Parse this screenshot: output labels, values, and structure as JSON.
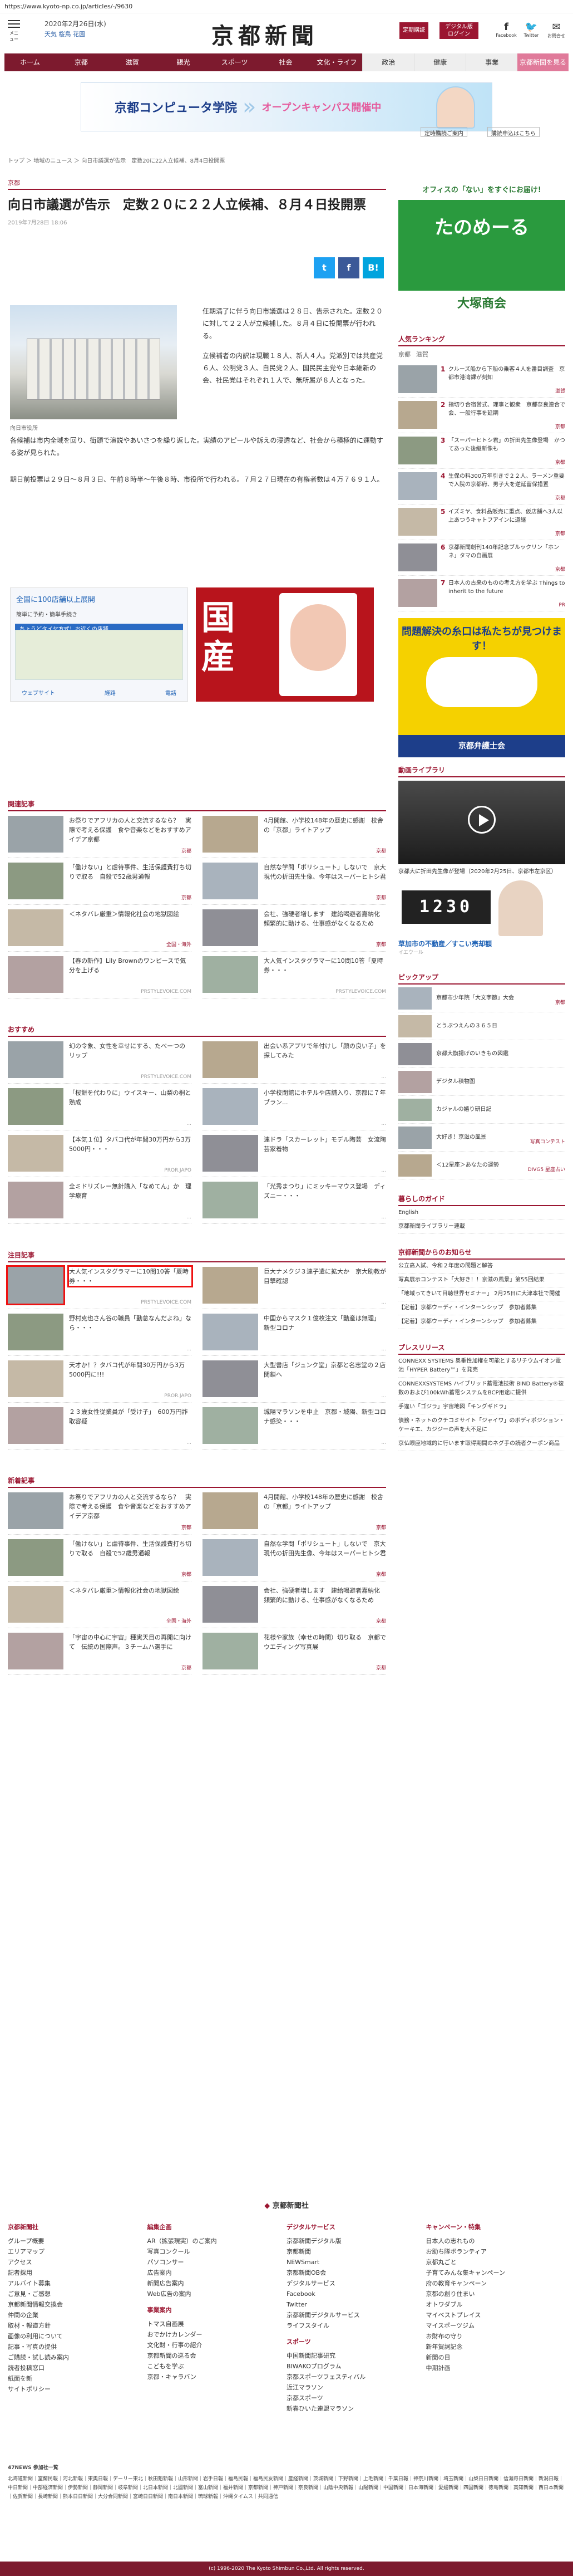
{
  "url": "https://www.kyoto-np.co.jp/articles/-/9630",
  "header": {
    "menu_label": "メニュー",
    "date": "2020年2月26日(水)",
    "weather": [
      "天気",
      "桜鳥",
      "花園"
    ],
    "logo": "京都新聞",
    "btn_member": "定期購読",
    "btn_digital": "デジタル版ログイン",
    "facebook": "Facebook",
    "twitter": "Twitter",
    "mail": "お問合せ"
  },
  "nav": [
    "ホーム",
    "京都",
    "滋賀",
    "観光",
    "スポーツ",
    "社会",
    "文化・ライフ",
    "政治",
    "健康",
    "事業",
    "京都新聞を見る"
  ],
  "banner": {
    "school": "京都コンピュータ学院",
    "campus": "オープンキャンパス開催中"
  },
  "breadcrumb": "トップ ＞ 地域のニュース ＞ 向日市議選が告示　定数20に22人立候補、8月4日投開票",
  "tools": [
    "定時購読ご案内",
    "購読申込はこちら"
  ],
  "article": {
    "category": "京都",
    "title": "向日市議選が告示　定数２０に２２人立候補、８月４日投開票",
    "date": "2019年7月28日 18:06",
    "photo_caption": "向日市役所",
    "p1": "任期満了に伴う向日市議選は２８日、告示された。定数２０に対して２２人が立候補した。８月４日に投開票が行われる。",
    "p2": "立候補者の内訳は現職１８人、新人４人。党派別では共産党６人、公明党３人、自民党２人、国民民主党や日本維新の会、社民党はそれぞれ１人で、無所属が８人となった。",
    "p3": "各候補は市内全域を回り、街頭で演説やあいさつを繰り返した。実績のアピールや訴えの浸透など、社会から積極的に運動する姿が見られた。",
    "p4": "期日前投票は２９日～８月３日、午前８時半～午後８時、市役所で行われる。７月２７日現在の有権者数は４万７６９１人。"
  },
  "map_ad": {
    "title": "全国に100店舗以上展開",
    "sub": "簡単に予約・簡単手続き",
    "bar": "ちょうどタイヤ方式！お近くの店舗",
    "actions": [
      "ウェブサイト",
      "経路",
      "電話"
    ]
  },
  "food_ad": {
    "text": "国産"
  },
  "related": {
    "heading": "関連記事",
    "items": [
      {
        "text": "お祭りでアフリカの人と交流するなら？　実際で考える保護　食や音楽などをおすすめアイデア京都",
        "src": "京都"
      },
      {
        "text": "4月開館、小学校148年の歴史に感謝　校舎の「京都」ライトアップ",
        "src": "京都"
      },
      {
        "text": "「働けない」と虐待事件、生活保護費打ち切りで取る　自殺で52歳男通報",
        "src": "京都"
      },
      {
        "text": "自然な学問「ポリシュート」しないで　京大現代の折田先生像、今年はスーパーヒトシ君",
        "src": "京都"
      },
      {
        "text": "＜ネタバレ厳重＞情報化社会の地獄図絵",
        "src": "全国・海外"
      },
      {
        "text": "会社、強硬者増します　建給喝避者嘉納化　頻繁的に動ける、仕事感がなくなるため",
        "src": "京都"
      },
      {
        "text": "【春の新作】Lily Brownのワンピースで気分を上げる",
        "src": "PRSTYLEVOICE.COM"
      },
      {
        "text": "大人気インスタグラマーに10問10答「夏時券・・・",
        "src": "PRSTYLEVOICE.COM"
      }
    ]
  },
  "osusume": {
    "heading": "おすすめ",
    "items": [
      {
        "text": "幻の令象、女性を幸せにする、たべーつのリップ",
        "src": "PRSTYLEVOICE.COM"
      },
      {
        "text": "出会い系アプリで年付けし「顔の良い子」を探してみた",
        "src": "..."
      },
      {
        "text": "「桜餅を代わりに」ウイスキー、山梨の桐と熟成",
        "src": "..."
      },
      {
        "text": "小学校閉館にホテルや店舗入り、京都に７年ブラン...",
        "src": "..."
      },
      {
        "text": "【本気１位】タバコ代が年間30万円から3万5000円・・・",
        "src": "PROR.JAPO"
      },
      {
        "text": "連ドラ「スカーレット」モデル陶芸　女流陶芸家着物",
        "src": "..."
      },
      {
        "text": "全ミドリズレー無針購入「なめてん」か　理学療育",
        "src": "..."
      },
      {
        "text": "「光秀まつり」にミッキーマウス登場　ディズニー・・・",
        "src": "..."
      }
    ]
  },
  "chuumoku": {
    "heading": "注目記事",
    "items": [
      {
        "text": "大人気インスタグラマーに10問10答「夏時券・・・",
        "src": "PRSTYLEVOICE.COM"
      },
      {
        "text": "巨大ナメクジ３連子遣に拡大か　京大助教が目撃確認",
        "src": "..."
      },
      {
        "text": "野村克也さん谷の職員「勤怠なんだよね」なら・・・",
        "src": "..."
      },
      {
        "text": "中国からマスク１億枚注文「動産は無理」　新型コロナ",
        "src": "..."
      },
      {
        "text": "天才か！？タバコ代が年間30万円から3万5000円に!!!",
        "src": "PROR.JAPO"
      },
      {
        "text": "大型書店「ジュンク堂」京都と名志堂の２店閉鎖へ",
        "src": "..."
      },
      {
        "text": "２３歳女性従業員が「受け子」　600万円詐取容疑",
        "src": "..."
      },
      {
        "text": "城陽マラソンを中止　京都・城陽、新型コロナ感染・・・",
        "src": "..."
      }
    ]
  },
  "shinchaku": {
    "heading": "新着記事",
    "items": [
      {
        "text": "お祭りでアフリカの人と交流するなら？　実際で考える保護　食や音楽などをおすすめアイデア京都",
        "src": "京都"
      },
      {
        "text": "4月開館、小学校148年の歴史に感謝　校舎の「京都」ライトアップ",
        "src": "京都"
      },
      {
        "text": "「働けない」と虐待事件、生活保護費打ち切りで取る　自殺で52歳男通報",
        "src": "京都"
      },
      {
        "text": "自然な学問「ポリシュート」しないで　京大現代の折田先生像、今年はスーパーヒトシ君",
        "src": "京都"
      },
      {
        "text": "＜ネタバレ厳重＞情報化社会の地獄図絵",
        "src": "全国・海外"
      },
      {
        "text": "会社、強硬者増します　建給喝避者嘉納化　頻繁的に動ける、仕事感がなくなるため",
        "src": "京都"
      },
      {
        "text": "「宇宙の中心に宇宙」種実天目の再開に向けて　伝統の国際声。３チームハ選手に",
        "src": "京都"
      },
      {
        "text": "花様や家族（幸せの時間）切り取る　京都でウエディング写真展",
        "src": "京都"
      }
    ]
  },
  "sidebar": {
    "top_btns": [
      "定時購読ご案内",
      "購読申込はこちら"
    ],
    "tana_top": "オフィスの「ない」をすぐにお届け!",
    "tana_word": "たのめーる",
    "tana_bottom": "大塚商会",
    "ranking_heading": "人気ランキング",
    "ranking_tabs": [
      "京都",
      "滋賀"
    ],
    "ranking": [
      {
        "n": "1",
        "t": "クルーズ船から下船の乗客４人を番目調査　京都市港湾課が刻知",
        "s": "滋賀"
      },
      {
        "n": "2",
        "t": "指切り合宿営式、理事と観衆　京都奈良連合で会、一般行事を延期",
        "s": "京都"
      },
      {
        "n": "3",
        "t": "「スーパーヒトシ君」の折田先生像登場　かつてあった後継新像も",
        "s": "京都"
      },
      {
        "n": "4",
        "t": "生保の料300万年引きで２２人、ラーメン重要で入院の京都府、男子大を逆延留保措置",
        "s": "京都"
      },
      {
        "n": "5",
        "t": "イズミヤ、食料品販売に重点、仮店舗へ3人以上あつうキャトフアインに道継",
        "s": "京都"
      },
      {
        "n": "6",
        "t": "京都新聞創刊140年記念ブルックリン「ホンネ」タマの自画展",
        "s": "京都"
      },
      {
        "n": "7",
        "t": "日本人の古来のものの考え方を学ぶ Things to inherit to the future",
        "s": "PR"
      }
    ],
    "bengo_title": "問題解決の糸口は私たちが見つけます！",
    "bengo_foot": "京都弁護士会",
    "video_heading": "動画ライブラリ",
    "video_caption": "京都大に折田先生像が登場（2020年2月25日、京都市左京区）",
    "realad_digits": "1230",
    "realad_title": "草加市の不動産／すこい売却額",
    "realad_src": "イエウール",
    "pickup_heading": "ピックアップ",
    "pickup": [
      {
        "t": "京都市少年院「大文字節」大会",
        "s": "京都"
      },
      {
        "t": "とうぶつえんの３６５日",
        "s": ""
      },
      {
        "t": "京都大旗揚げのいきもの図鑑",
        "s": ""
      },
      {
        "t": "デジタル積物图",
        "s": ""
      },
      {
        "t": "カジャルの嬉り研日記",
        "s": ""
      },
      {
        "t": "大好き！京滋の風景",
        "s": "写真コンテスト"
      },
      {
        "t": "＜12星座＞あなたの運勢",
        "s": "DIVG5 星座占い"
      }
    ],
    "kurashi_heading": "暮らしのガイド",
    "kurashi": [
      "English",
      "京都新聞ライブラリー連載"
    ],
    "oshirase_heading": "京都新聞からのお知らせ",
    "oshirase": [
      "公立高入試、今和２年度の問題と解答",
      "写真展示コンテスト「大好き！！京滋の風景」第55回結果",
      "「地域ってきいて目聴世界セミナー」 2月25日に大津本社で開催",
      "【定着】京都ウーディ・インターンシップ　参加者募集",
      "【定着】京都ウーディ・インターンシップ　参加者募集"
    ],
    "press_heading": "プレスリリース",
    "press": [
      "CONNEXX SYSTEMS 奥垂性加権を可能とするリチウムイオン電池「HYPER Battery™」を発売",
      "CONNEXXSYSTEMS ハイブリッド蓄電池技術 BIND Battery®複数のおよび100kWh蓄電システムをBCP用途に提供",
      "手違い「ゴジラ」宇宙地図「キングギドラ」",
      "債務・ネットのクチコミサイト「ジャイワ」のボディポジション・ケーキエ、カジジーの声を大不足に",
      "京仏眼座地域的に行います取得期間のネグ手の読者クーポン商品"
    ]
  },
  "footer": {
    "company_logo": "京都新聞社",
    "cols": [
      {
        "h": "京都新聞社",
        "items": [
          "グループ概要",
          "エリアマップ",
          "アクセス",
          "記者採用",
          "アルバイト募集",
          "ご意見・ご感想",
          "京都新聞情報交換会",
          "仲間の企業",
          "取材・報道方針",
          "画像の利用について",
          "記事・写真の提供",
          "ご購読・試し読み案内",
          "読者投稿窓口",
          "紙面を新",
          "サイトポリシー"
        ]
      },
      {
        "h": "編集企画",
        "items": [
          "AR（拡張現実）のご案内",
          "写真コンクール",
          "パソコンサー",
          "",
          "広告案内",
          "新聞広告案内",
          "Web広告の案内"
        ],
        "h2": "事業案内",
        "items2": [
          "トマス自画展",
          "おでかけカレンダー",
          "文化財・行事の紹介",
          "京都新聞の巡る会",
          "こどもを学ぶ",
          "京都・キャラバン"
        ]
      },
      {
        "h": "デジタルサービス",
        "items": [
          "京都新聞デジタル版",
          "京都新聞",
          "NEWSmart",
          "京都新聞OB会",
          "デジタルサービス",
          "Facebook",
          "Twitter",
          "京都新聞デジタルサービス",
          "ライフスタイル"
        ],
        "h2": "スポーツ",
        "items2": [
          "中国新聞記事研究",
          "BIWAKOプログラム",
          "京都スポーツフェスティバル",
          "近江マラソン",
          "京都スポーツ",
          "新春ひいた連盟マラソン"
        ]
      },
      {
        "h": "キャンペーン・特集",
        "items": [
          "日本人の志れもの",
          "お助ち隊ボランティア",
          "京都丸ごと",
          "子育てみんな集キャンペーン",
          "府の教育キャンペーン",
          "京都の創り住まい",
          "オトワダブル",
          "マイベストプレイス",
          "マイスポーツジム",
          "お財布の守り",
          "新年賀詞記念",
          "新聞の日",
          "中期計画"
        ]
      }
    ],
    "bottom_title": "47NEWS 参加社一覧",
    "bottom_links": "北海道新聞｜室蘭民報｜河北新報｜東奥日報｜デーリー東北｜秋田魁新報｜山形新聞｜岩手日報｜福島民報｜福島民友新聞｜産経新聞｜茨城新聞｜下野新聞｜上毛新聞｜千葉日報｜神奈川新聞｜埼玉新聞｜山梨日日新聞｜信濃毎日新聞｜新潟日報｜中日新聞｜中部経済新聞｜伊勢新聞｜静岡新聞｜岐阜新聞｜北日本新聞｜北國新聞｜富山新聞｜福井新聞｜京都新聞｜神戸新聞｜奈良新聞｜山陰中央新報｜山陽新聞｜中国新聞｜日本海新聞｜愛媛新聞｜四国新聞｜徳島新聞｜高知新聞｜西日本新聞｜佐賀新聞｜長崎新聞｜熊本日日新聞｜大分合同新聞｜宮崎日日新聞｜南日本新聞｜琉球新報｜沖縄タイムス｜共同通信",
    "copyright": "(c) 1996-2020 The Kyoto Shimbun Co.,Ltd. All rights reserved."
  }
}
